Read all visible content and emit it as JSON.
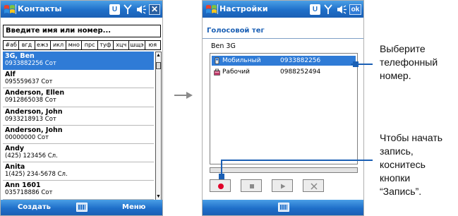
{
  "left_screen": {
    "title": "Контакты",
    "search_placeholder": "Введите имя или номер...",
    "alpha_index": [
      "#аб",
      "вгд",
      "ежз",
      "икл",
      "мно",
      "прс",
      "туф",
      "хцч",
      "шщэ",
      "юя"
    ],
    "contacts": [
      {
        "name": "3G, Ben",
        "info": "0933882256  Сот",
        "selected": true
      },
      {
        "name": "Alf",
        "info": "095559637  Сот",
        "selected": false
      },
      {
        "name": "Anderson, Ellen",
        "info": "0912865038  Сот",
        "selected": false
      },
      {
        "name": "Anderson, John",
        "info": "0933218913  Сот",
        "selected": false
      },
      {
        "name": "Anderson, John",
        "info": "00000000  Сот",
        "selected": false
      },
      {
        "name": "Andy",
        "info": "(425) 123456  Сл.",
        "selected": false
      },
      {
        "name": "Anita",
        "info": "1(425) 234-5678  Сл.",
        "selected": false
      },
      {
        "name": "Ann 1601",
        "info": "035718886  Сот",
        "selected": false
      }
    ],
    "left_softkey": "Создать",
    "right_softkey": "Меню",
    "icons": {
      "start": "windows-start-icon",
      "input": "input-u-icon",
      "signal": "signal-icon",
      "volume": "volume-icon",
      "close": "close-icon",
      "keyboard": "keyboard-icon"
    }
  },
  "right_screen": {
    "title": "Настройки",
    "ok_label": "ok",
    "heading": "Голосовой тег",
    "contact_name": "Ben 3G",
    "numbers": [
      {
        "type": "Мобильный",
        "number": "0933882256",
        "selected": true,
        "icon": "mobile-phone-icon"
      },
      {
        "type": "Рабочий",
        "number": "0988252494",
        "selected": false,
        "icon": "work-phone-icon"
      }
    ],
    "controls": [
      "record-icon",
      "stop-icon",
      "play-icon",
      "delete-icon"
    ],
    "record_color": "#e0002a"
  },
  "annotations": {
    "select_number": "Выберите\nтелефонный\nномер.",
    "start_record": "Чтобы начать\nзапись,\nкоснитесь\nкнопки\n“Запись”."
  },
  "colors": {
    "accent": "#1f6fc9",
    "selection": "#2f7bd6",
    "connector": "#1a5fb4"
  }
}
